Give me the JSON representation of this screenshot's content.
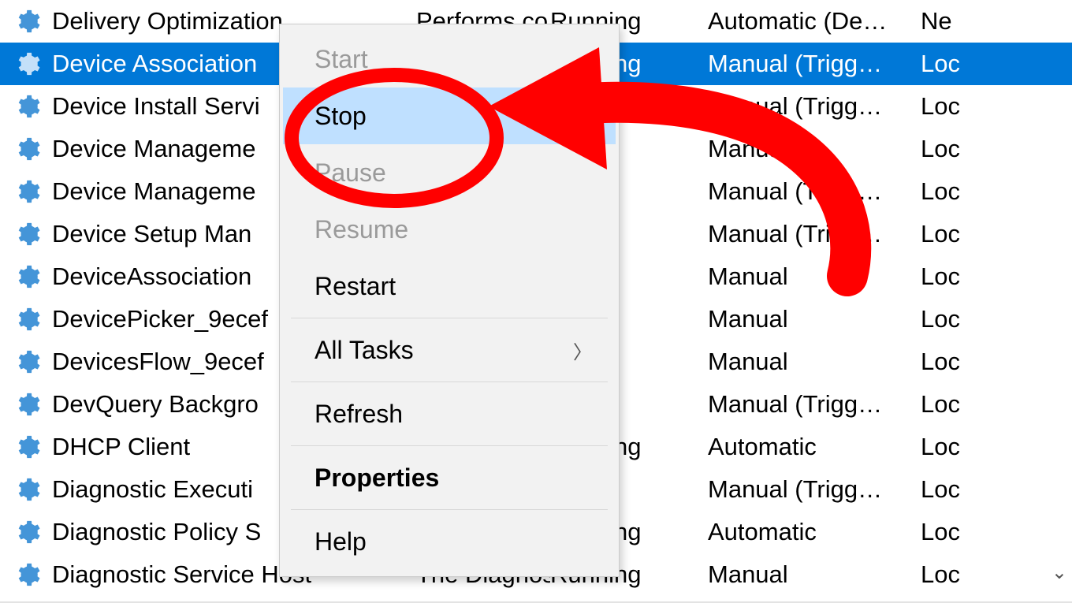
{
  "selected_index": 1,
  "rows": [
    {
      "name": "Delivery Optimization",
      "desc": "Performs co…",
      "status": "Running",
      "startup": "Automatic (De…",
      "logon": "Ne"
    },
    {
      "name": "Device Association",
      "desc": "",
      "status": "Running",
      "startup": "Manual (Trigg…",
      "logon": "Loc"
    },
    {
      "name": "Device Install Servi",
      "desc": "",
      "status": "",
      "startup": "Manual (Trigg…",
      "logon": "Loc"
    },
    {
      "name": "Device Manageme",
      "desc": "",
      "status": "",
      "startup": "Manual",
      "logon": "Loc"
    },
    {
      "name": "Device Manageme",
      "desc": "",
      "status": "",
      "startup": "Manual (Trigg…",
      "logon": "Loc"
    },
    {
      "name": "Device Setup Man",
      "desc": "",
      "status": "",
      "startup": "Manual (Trigg…",
      "logon": "Loc"
    },
    {
      "name": "DeviceAssociation",
      "desc": "",
      "status": "",
      "startup": "Manual",
      "logon": "Loc"
    },
    {
      "name": "DevicePicker_9ecef",
      "desc": "",
      "status": "",
      "startup": "Manual",
      "logon": "Loc"
    },
    {
      "name": "DevicesFlow_9ecef",
      "desc": "",
      "status": "",
      "startup": "Manual",
      "logon": "Loc"
    },
    {
      "name": "DevQuery Backgro",
      "desc": "",
      "status": "",
      "startup": "Manual (Trigg…",
      "logon": "Loc"
    },
    {
      "name": "DHCP Client",
      "desc": "",
      "status": "Running",
      "startup": "Automatic",
      "logon": "Loc"
    },
    {
      "name": "Diagnostic Executi",
      "desc": "",
      "status": "",
      "startup": "Manual (Trigg…",
      "logon": "Loc"
    },
    {
      "name": "Diagnostic Policy S",
      "desc": "",
      "status": "Running",
      "startup": "Automatic",
      "logon": "Loc"
    },
    {
      "name": "Diagnostic Service Host",
      "desc": "The Diagnos…",
      "status": "Running",
      "startup": "Manual",
      "logon": "Loc"
    }
  ],
  "context_menu": {
    "start": "Start",
    "stop": "Stop",
    "pause": "Pause",
    "resume": "Resume",
    "restart": "Restart",
    "all_tasks": "All Tasks",
    "refresh": "Refresh",
    "properties": "Properties",
    "help": "Help"
  }
}
